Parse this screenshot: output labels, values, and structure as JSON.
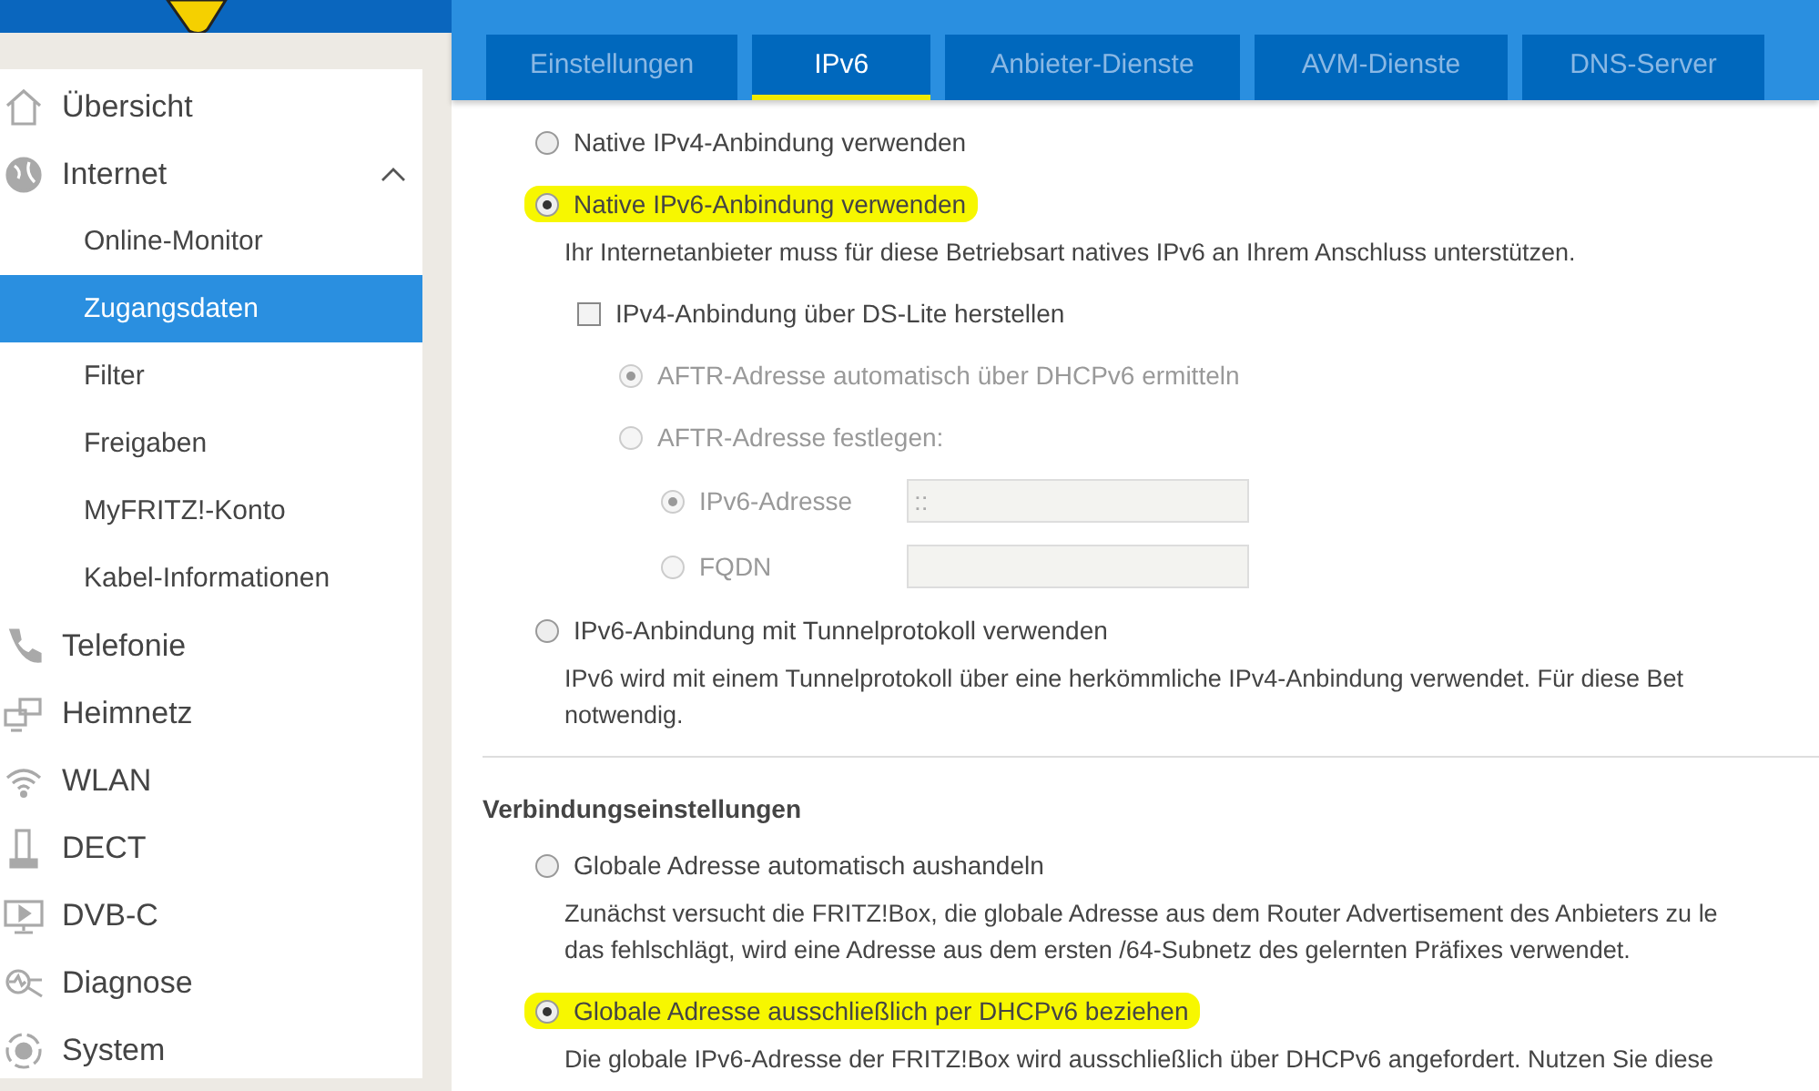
{
  "tabs": [
    {
      "label": "Einstellungen",
      "selected": false
    },
    {
      "label": "IPv6",
      "selected": true
    },
    {
      "label": "Anbieter-Dienste",
      "selected": false
    },
    {
      "label": "AVM-Dienste",
      "selected": false
    },
    {
      "label": "DNS-Server",
      "selected": false
    }
  ],
  "sidebar": {
    "items": [
      {
        "label": "Übersicht",
        "selected": false
      },
      {
        "label": "Internet",
        "selected": false,
        "expanded": true,
        "children": [
          {
            "label": "Online-Monitor",
            "selected": false
          },
          {
            "label": "Zugangsdaten",
            "selected": true
          },
          {
            "label": "Filter",
            "selected": false
          },
          {
            "label": "Freigaben",
            "selected": false
          },
          {
            "label": "MyFRITZ!-Konto",
            "selected": false
          },
          {
            "label": "Kabel-Informationen",
            "selected": false
          }
        ]
      },
      {
        "label": "Telefonie",
        "selected": false
      },
      {
        "label": "Heimnetz",
        "selected": false
      },
      {
        "label": "WLAN",
        "selected": false
      },
      {
        "label": "DECT",
        "selected": false
      },
      {
        "label": "DVB-C",
        "selected": false
      },
      {
        "label": "Diagnose",
        "selected": false
      },
      {
        "label": "System",
        "selected": false
      }
    ]
  },
  "sections": [
    {
      "options": [
        {
          "kind": "radio",
          "label": "Native IPv4-Anbindung verwenden",
          "selected": false,
          "highlighted": false,
          "disabled": false
        },
        {
          "kind": "radio",
          "label": "Native IPv6-Anbindung verwenden",
          "selected": true,
          "highlighted": true,
          "disabled": false,
          "description": [
            "Ihr Internetanbieter muss für diese Betriebsart natives IPv6 an Ihrem Anschluss unterstützen."
          ],
          "children": [
            {
              "kind": "checkbox",
              "label": "IPv4-Anbindung über DS-Lite herstellen",
              "checked": false,
              "children": [
                {
                  "kind": "radio",
                  "label": "AFTR-Adresse automatisch über DHCPv6 ermitteln",
                  "selected": true,
                  "disabled": true
                },
                {
                  "kind": "radio",
                  "label": "AFTR-Adresse festlegen:",
                  "selected": false,
                  "disabled": true,
                  "children": [
                    {
                      "kind": "radio_field",
                      "label": "IPv6-Adresse",
                      "selected": true,
                      "disabled": true,
                      "value": "::"
                    },
                    {
                      "kind": "radio_field",
                      "label": "FQDN",
                      "selected": false,
                      "disabled": true
                    }
                  ]
                }
              ]
            }
          ]
        },
        {
          "kind": "radio",
          "label": "IPv6-Anbindung mit Tunnelprotokoll verwenden",
          "selected": false,
          "highlighted": false,
          "disabled": false,
          "description": [
            "IPv6 wird mit einem Tunnelprotokoll über eine herkömmliche IPv4-Anbindung verwendet. Für diese Bet",
            "notwendig."
          ]
        }
      ]
    },
    {
      "heading": "Verbindungseinstellungen",
      "options": [
        {
          "kind": "radio",
          "label": "Globale Adresse automatisch aushandeln",
          "selected": false,
          "highlighted": false,
          "disabled": false,
          "description": [
            "Zunächst versucht die FRITZ!Box, die globale Adresse aus dem Router Advertisement des Anbieters zu le",
            "das fehlschlägt, wird eine Adresse aus dem ersten /64-Subnetz des gelernten Präfixes verwendet."
          ]
        },
        {
          "kind": "radio",
          "label": "Globale Adresse ausschließlich per DHCPv6 beziehen",
          "selected": true,
          "highlighted": true,
          "disabled": false,
          "description": [
            "Die globale IPv6-Adresse der FRITZ!Box wird ausschließlich über DHCPv6 angefordert. Nutzen Sie diese"
          ]
        }
      ]
    }
  ]
}
